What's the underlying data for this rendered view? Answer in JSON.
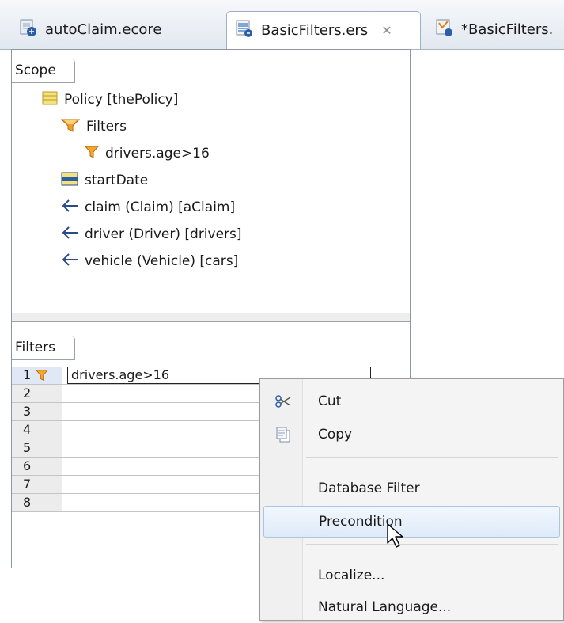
{
  "tabs": [
    {
      "label": "autoClaim.ecore",
      "active": false
    },
    {
      "label": "BasicFilters.ers",
      "active": true,
      "close_glyph": "✕"
    },
    {
      "label": "*BasicFilters.",
      "active": false
    }
  ],
  "scope": {
    "header": "Scope",
    "tree": [
      {
        "label": "Policy [thePolicy]",
        "icon": "entity-icon"
      },
      {
        "label": "Filters",
        "icon": "filters-folder-icon"
      },
      {
        "label": "drivers.age>16",
        "icon": "filter-icon"
      },
      {
        "label": "startDate",
        "icon": "attribute-icon"
      },
      {
        "label": "claim (Claim) [aClaim]",
        "icon": "association-icon"
      },
      {
        "label": "driver (Driver) [drivers]",
        "icon": "association-icon"
      },
      {
        "label": "vehicle (Vehicle) [cars]",
        "icon": "association-icon"
      }
    ]
  },
  "filters": {
    "header": "Filters",
    "rows": [
      {
        "num": "1",
        "value": "drivers.age>16"
      },
      {
        "num": "2",
        "value": ""
      },
      {
        "num": "3",
        "value": ""
      },
      {
        "num": "4",
        "value": ""
      },
      {
        "num": "5",
        "value": ""
      },
      {
        "num": "6",
        "value": ""
      },
      {
        "num": "7",
        "value": ""
      },
      {
        "num": "8",
        "value": ""
      }
    ]
  },
  "context_menu": {
    "items": [
      {
        "label": "Cut",
        "icon": "scissors-icon"
      },
      {
        "label": "Copy",
        "icon": "copy-icon"
      },
      {
        "label": "Database Filter"
      },
      {
        "label": "Precondition",
        "highlighted": true
      },
      {
        "label": "Localize..."
      },
      {
        "label": "Natural Language..."
      }
    ]
  },
  "colors": {
    "accent_blue": "#2a5ea8",
    "filter_orange": "#f0a02a",
    "menu_highlight_border": "#a9c5e8"
  }
}
